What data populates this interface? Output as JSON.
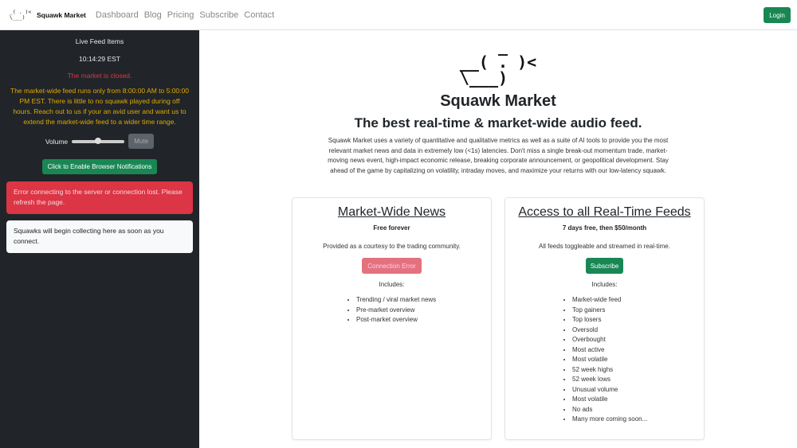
{
  "navbar": {
    "logo_art": " _( . )<\n \\___)",
    "brand": "Squawk Market",
    "links": [
      "Dashboard",
      "Blog",
      "Pricing",
      "Subscribe",
      "Contact"
    ],
    "login_label": "Login"
  },
  "sidebar": {
    "title": "Live Feed Items",
    "time": "10:14:29 EST",
    "market_status": "The market is closed.",
    "warning": "The market-wide feed runs only from 8:00:00 AM to 5:00:00 PM EST. There is little to no squawk played during off hours. Reach out to us if your an avid user and want us to extend the market-wide feed to a wider time range.",
    "volume_label": "Volume",
    "volume_level": 0.5,
    "mute_label": "Mute",
    "notifications_label": "Click to Enable Browser Notifications",
    "error_alert": "Error connecting to the server or connection lost. Please refresh the page.",
    "info_alert": "Squawks will begin collecting here as soon as you connect."
  },
  "hero": {
    "logo_art": "    _\n__( . )<\n\\___)",
    "title": "Squawk Market",
    "subtitle": "The best real-time & market-wide audio feed.",
    "description": "Squawk Market uses a variety of quantitative and qualitative metrics as well as a suite of AI tools to provide you the most relevant market news and data in extremely low (<1s) latencies. Don't miss a single break-out momentum trade, market-moving news event, high-impact economic release, breaking corporate announcement, or geopolitical development. Stay ahead of the game by capitalizing on volatility, intraday moves, and maximize your returns with our low-latency squawk."
  },
  "cards": [
    {
      "title": "Market-Wide News",
      "price": "Free forever",
      "description": "Provided as a courtesy to the trading community.",
      "button_label": "Connection Error",
      "includes_label": "Includes:",
      "features": [
        "Trending / viral market news",
        "Pre-market overview",
        "Post-market overview"
      ]
    },
    {
      "title": "Access to all Real-Time Feeds",
      "price": "7 days free, then $50/month",
      "description": "All feeds toggleable and streamed in real-time.",
      "button_label": "Subscribe",
      "includes_label": "Includes:",
      "features": [
        "Market-wide feed",
        "Top gainers",
        "Top losers",
        "Oversold",
        "Overbought",
        "Most active",
        "Most volatile",
        "52 week highs",
        "52 week lows",
        "Unusual volume",
        "Most volatile",
        "No ads",
        "Many more coming soon..."
      ]
    }
  ]
}
